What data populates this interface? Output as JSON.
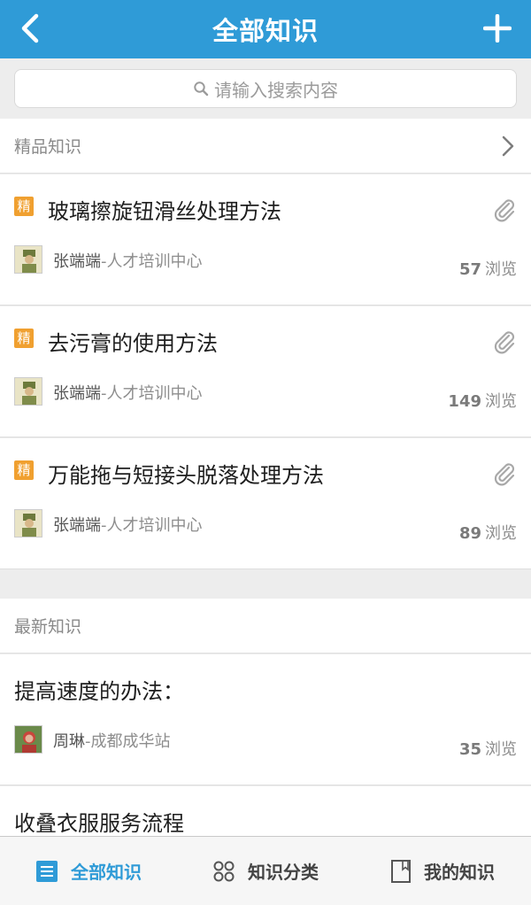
{
  "header": {
    "title": "全部知识"
  },
  "search": {
    "placeholder": "请输入搜索内容"
  },
  "featured": {
    "heading": "精品知识",
    "tag_label": "精",
    "items": [
      {
        "title": "玻璃擦旋钮滑丝处理方法",
        "author": "张端端",
        "org": "-人才培训中心",
        "views": "57",
        "views_unit": "浏览"
      },
      {
        "title": "去污膏的使用方法",
        "author": "张端端",
        "org": "-人才培训中心",
        "views": "149",
        "views_unit": "浏览"
      },
      {
        "title": "万能拖与短接头脱落处理方法",
        "author": "张端端",
        "org": "-人才培训中心",
        "views": "89",
        "views_unit": "浏览"
      }
    ]
  },
  "latest": {
    "heading": "最新知识",
    "items": [
      {
        "title": "提高速度的办法：",
        "author": "周琳",
        "org": "-成都成华站",
        "views": "35",
        "views_unit": "浏览"
      },
      {
        "title": "收叠衣服服务流程"
      }
    ]
  },
  "tabs": [
    {
      "label": "全部知识",
      "icon": "list-icon",
      "active": true
    },
    {
      "label": "知识分类",
      "icon": "grid-icon",
      "active": false
    },
    {
      "label": "我的知识",
      "icon": "bookmark-icon",
      "active": false
    }
  ],
  "colors": {
    "accent": "#2f9bd7",
    "tag": "#f0a030"
  }
}
